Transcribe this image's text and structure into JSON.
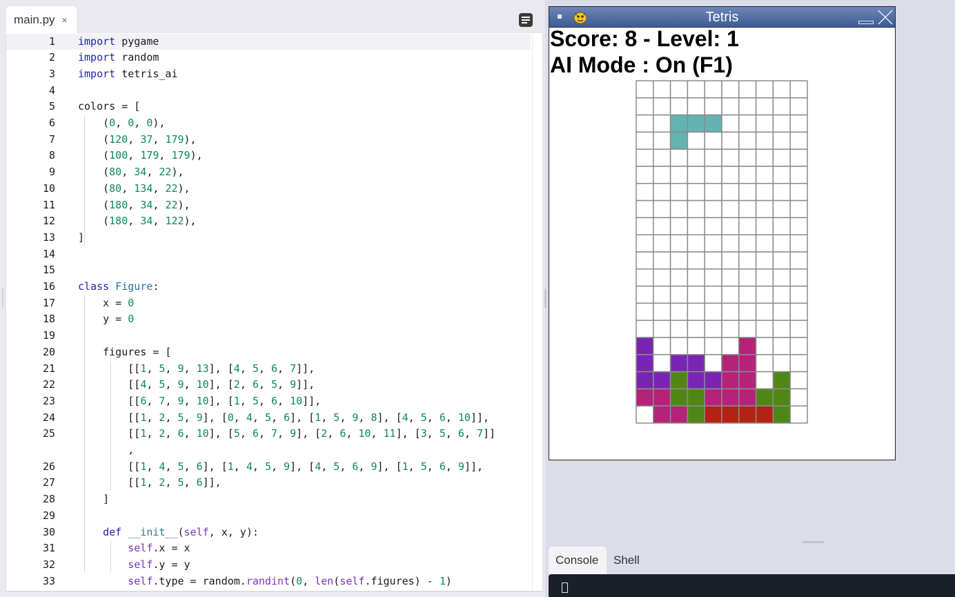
{
  "editor": {
    "tab": {
      "filename": "main.py",
      "close_glyph": "×"
    },
    "lines": [
      {
        "n": "1",
        "t": "import pygame"
      },
      {
        "n": "2",
        "t": "import random"
      },
      {
        "n": "3",
        "t": "import tetris_ai"
      },
      {
        "n": "4",
        "t": ""
      },
      {
        "n": "5",
        "t": "colors = ["
      },
      {
        "n": "6",
        "t": "    (0, 0, 0),"
      },
      {
        "n": "7",
        "t": "    (120, 37, 179),"
      },
      {
        "n": "8",
        "t": "    (100, 179, 179),"
      },
      {
        "n": "9",
        "t": "    (80, 34, 22),"
      },
      {
        "n": "10",
        "t": "    (80, 134, 22),"
      },
      {
        "n": "11",
        "t": "    (180, 34, 22),"
      },
      {
        "n": "12",
        "t": "    (180, 34, 122),"
      },
      {
        "n": "13",
        "t": "]"
      },
      {
        "n": "14",
        "t": ""
      },
      {
        "n": "15",
        "t": ""
      },
      {
        "n": "16",
        "t": "class Figure:"
      },
      {
        "n": "17",
        "t": "    x = 0"
      },
      {
        "n": "18",
        "t": "    y = 0"
      },
      {
        "n": "19",
        "t": ""
      },
      {
        "n": "20",
        "t": "    figures = ["
      },
      {
        "n": "21",
        "t": "        [[1, 5, 9, 13], [4, 5, 6, 7]],"
      },
      {
        "n": "22",
        "t": "        [[4, 5, 9, 10], [2, 6, 5, 9]],"
      },
      {
        "n": "23",
        "t": "        [[6, 7, 9, 10], [1, 5, 6, 10]],"
      },
      {
        "n": "24",
        "t": "        [[1, 2, 5, 9], [0, 4, 5, 6], [1, 5, 9, 8], [4, 5, 6, 10]],"
      },
      {
        "n": "25",
        "t": "        [[1, 2, 6, 10], [5, 6, 7, 9], [2, 6, 10, 11], [3, 5, 6, 7]]"
      },
      {
        "n": "",
        "t": "        ,"
      },
      {
        "n": "26",
        "t": "        [[1, 4, 5, 6], [1, 4, 5, 9], [4, 5, 6, 9], [1, 5, 6, 9]],"
      },
      {
        "n": "27",
        "t": "        [[1, 2, 5, 6]],"
      },
      {
        "n": "28",
        "t": "    ]"
      },
      {
        "n": "29",
        "t": ""
      },
      {
        "n": "30",
        "t": "    def __init__(self, x, y):"
      },
      {
        "n": "31",
        "t": "        self.x = x"
      },
      {
        "n": "32",
        "t": "        self.y = y"
      },
      {
        "n": "33",
        "t": "        self.type = random.randint(0, len(self.figures) - 1)"
      }
    ]
  },
  "tetris_window": {
    "title": "Tetris",
    "score_text": "Score: 8 - Level: 1",
    "ai_mode_text": "AI Mode : On (F1)",
    "palette": {
      "1": "#7825b3",
      "2": "#64b3b3",
      "4": "#508616",
      "5": "#b42216",
      "6": "#b4227a"
    },
    "board_cols": 10,
    "board_rows": 20,
    "active_piece_cells": [
      [
        2,
        2
      ],
      [
        3,
        2
      ],
      [
        4,
        2
      ],
      [
        2,
        3
      ]
    ],
    "active_piece_color": 2,
    "locked_rows": [
      "1000006000",
      "1011066000",
      "1141166040",
      "6644666440",
      "0664555540"
    ]
  },
  "bottom_panel": {
    "tabs": [
      "Console",
      "Shell"
    ]
  }
}
